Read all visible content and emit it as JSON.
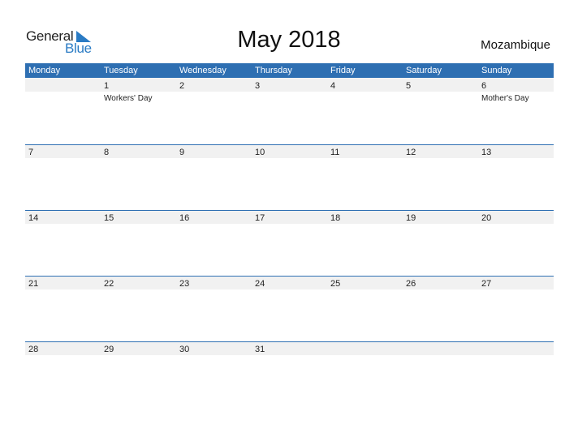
{
  "logo": {
    "line1": "General",
    "line2": "Blue"
  },
  "title": "May 2018",
  "country": "Mozambique",
  "colors": {
    "accent": "#2e6fb2",
    "logo_blue": "#2a7bc4",
    "band": "#f1f1f1"
  },
  "weekdays": [
    "Monday",
    "Tuesday",
    "Wednesday",
    "Thursday",
    "Friday",
    "Saturday",
    "Sunday"
  ],
  "weeks": [
    [
      {
        "day": ""
      },
      {
        "day": "1",
        "holiday": "Workers' Day"
      },
      {
        "day": "2"
      },
      {
        "day": "3"
      },
      {
        "day": "4"
      },
      {
        "day": "5"
      },
      {
        "day": "6",
        "holiday": "Mother's Day"
      }
    ],
    [
      {
        "day": "7"
      },
      {
        "day": "8"
      },
      {
        "day": "9"
      },
      {
        "day": "10"
      },
      {
        "day": "11"
      },
      {
        "day": "12"
      },
      {
        "day": "13"
      }
    ],
    [
      {
        "day": "14"
      },
      {
        "day": "15"
      },
      {
        "day": "16"
      },
      {
        "day": "17"
      },
      {
        "day": "18"
      },
      {
        "day": "19"
      },
      {
        "day": "20"
      }
    ],
    [
      {
        "day": "21"
      },
      {
        "day": "22"
      },
      {
        "day": "23"
      },
      {
        "day": "24"
      },
      {
        "day": "25"
      },
      {
        "day": "26"
      },
      {
        "day": "27"
      }
    ],
    [
      {
        "day": "28"
      },
      {
        "day": "29"
      },
      {
        "day": "30"
      },
      {
        "day": "31"
      },
      {
        "day": ""
      },
      {
        "day": ""
      },
      {
        "day": ""
      }
    ]
  ]
}
